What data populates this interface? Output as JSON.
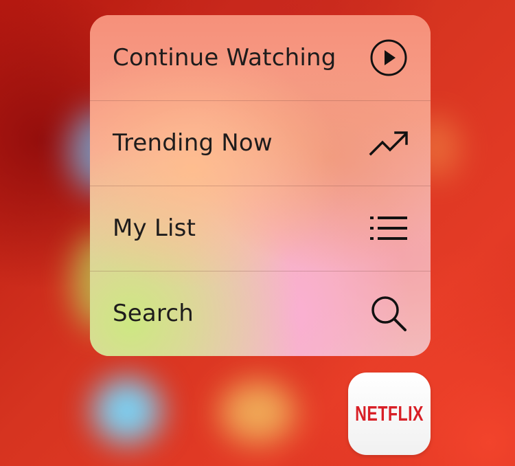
{
  "quick_actions_menu": {
    "items": [
      {
        "label": "Continue Watching",
        "icon": "play-circle-icon"
      },
      {
        "label": "Trending Now",
        "icon": "trending-up-icon"
      },
      {
        "label": "My List",
        "icon": "list-icon"
      },
      {
        "label": "Search",
        "icon": "search-icon"
      }
    ]
  },
  "app_icon": {
    "logo_text": "NETFLIX",
    "brand_color": "#d81f26"
  },
  "colors": {
    "wallpaper_red": "#c8241b",
    "label_text": "#1e1c1c"
  }
}
